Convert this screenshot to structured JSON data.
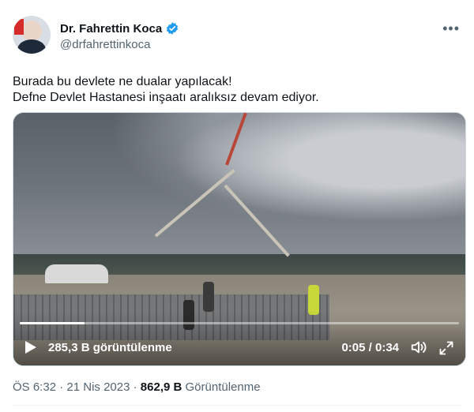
{
  "author": {
    "name": "Dr. Fahrettin Koca",
    "handle": "@drfahrettinkoca",
    "verified_color": "#1d9bf0"
  },
  "more_icon": "more-horizontal-icon",
  "tweet": {
    "lines": [
      "Burada bu devlete ne dualar yapılacak!",
      "Defne Devlet Hastanesi inşaatı aralıksız devam ediyor."
    ]
  },
  "video": {
    "views": "285,3 B görüntülenme",
    "time": "0:05 / 0:34",
    "progress_fraction": 0.147,
    "icons": [
      "play-icon",
      "sound-icon",
      "fullscreen-icon"
    ]
  },
  "meta": {
    "time": "ÖS 6:32",
    "sep": "·",
    "date": "21 Nis 2023",
    "views_count": "862,9 B",
    "views_label": "Görüntülenme"
  }
}
